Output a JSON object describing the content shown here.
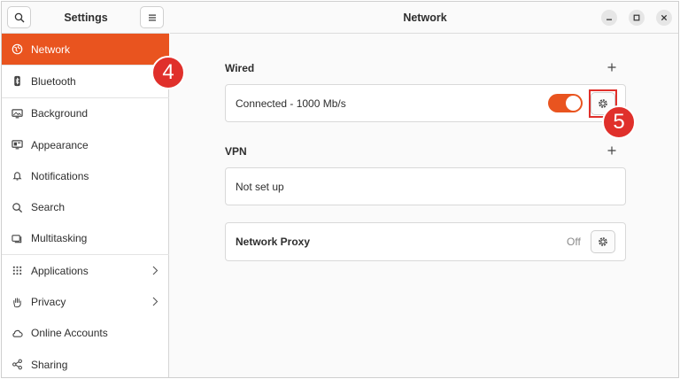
{
  "sidebar": {
    "title": "Settings",
    "search_icon": "search-icon",
    "menu_icon": "hamburger-menu-icon",
    "items": [
      {
        "label": "Network",
        "icon": "globe-icon",
        "active": true
      },
      {
        "label": "Bluetooth",
        "icon": "bluetooth-icon"
      },
      {
        "label": "Background",
        "icon": "monitor-icon"
      },
      {
        "label": "Appearance",
        "icon": "appearance-icon"
      },
      {
        "label": "Notifications",
        "icon": "bell-icon"
      },
      {
        "label": "Search",
        "icon": "search-icon"
      },
      {
        "label": "Multitasking",
        "icon": "multitasking-icon"
      },
      {
        "label": "Applications",
        "icon": "grid-icon",
        "chevron": true
      },
      {
        "label": "Privacy",
        "icon": "hand-icon",
        "chevron": true
      },
      {
        "label": "Online Accounts",
        "icon": "cloud-icon"
      },
      {
        "label": "Sharing",
        "icon": "share-icon"
      }
    ]
  },
  "main": {
    "title": "Network",
    "wired": {
      "label": "Wired",
      "status": "Connected - 1000 Mb/s",
      "toggle_on": true
    },
    "vpn": {
      "label": "VPN",
      "status": "Not set up"
    },
    "proxy": {
      "label": "Network Proxy",
      "state": "Off"
    }
  },
  "annotations": {
    "badge_4": "4",
    "badge_5": "5"
  },
  "colors": {
    "accent": "#e9541f",
    "annotation": "#e0302b"
  }
}
